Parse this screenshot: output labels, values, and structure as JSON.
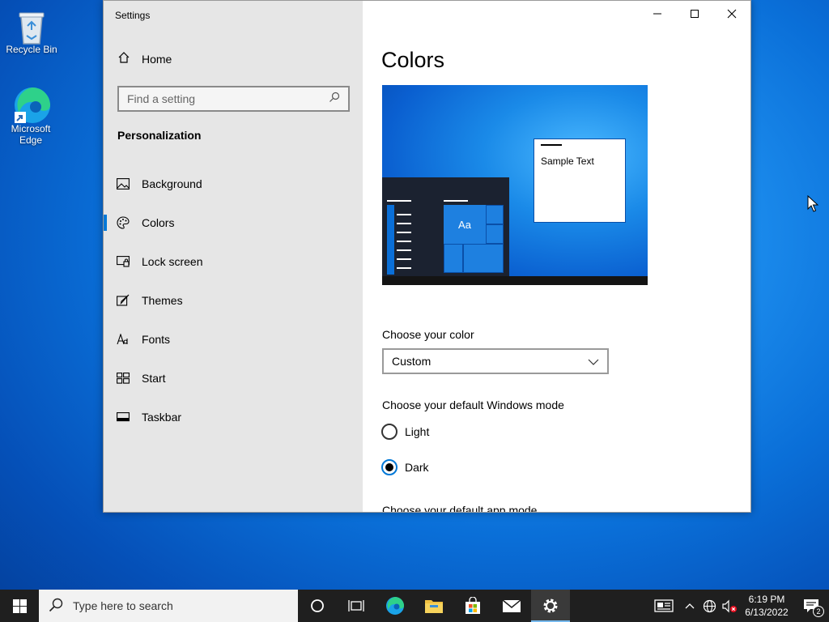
{
  "desktop": {
    "icons": [
      {
        "label": "Recycle Bin"
      },
      {
        "label": "Microsoft Edge"
      }
    ]
  },
  "window": {
    "title": "Settings",
    "nav": {
      "home_label": "Home",
      "search_placeholder": "Find a setting",
      "section_header": "Personalization",
      "items": [
        {
          "label": "Background",
          "icon": "picture-icon",
          "active": false
        },
        {
          "label": "Colors",
          "icon": "palette-icon",
          "active": true
        },
        {
          "label": "Lock screen",
          "icon": "lock-screen-icon",
          "active": false
        },
        {
          "label": "Themes",
          "icon": "brush-icon",
          "active": false
        },
        {
          "label": "Fonts",
          "icon": "fonts-icon",
          "active": false
        },
        {
          "label": "Start",
          "icon": "start-icon",
          "active": false
        },
        {
          "label": "Taskbar",
          "icon": "taskbar-icon",
          "active": false
        }
      ]
    },
    "content": {
      "title": "Colors",
      "preview": {
        "sample_text": "Sample Text",
        "tile_label": "Aa"
      },
      "choose_color_label": "Choose your color",
      "choose_color_value": "Custom",
      "windows_mode_label": "Choose your default Windows mode",
      "windows_mode_options": [
        {
          "label": "Light",
          "selected": false
        },
        {
          "label": "Dark",
          "selected": true
        }
      ],
      "app_mode_label": "Choose your default app mode"
    }
  },
  "taskbar": {
    "search_placeholder": "Type here to search",
    "clock_time": "6:19 PM",
    "clock_date": "6/13/2022",
    "notification_count": "2"
  },
  "colors": {
    "accent": "#0078d7",
    "nav_bg": "#e6e6e6",
    "taskbar_bg": "#1f1f1f"
  }
}
